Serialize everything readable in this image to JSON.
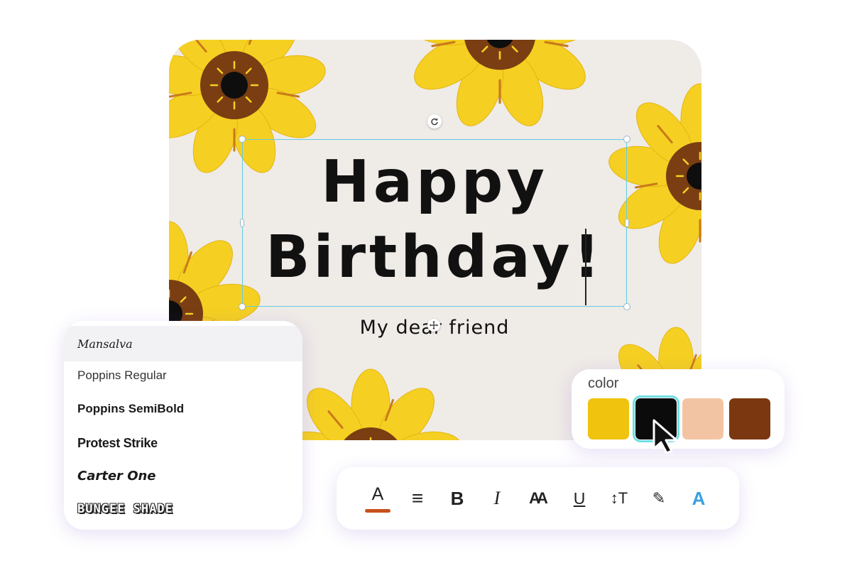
{
  "card": {
    "headline_line1": "Happy",
    "headline_line2": "Birthday!",
    "subline": "My dear friend",
    "background_color": "#efebe7",
    "petal_color": "#f5d022",
    "center_color": "#7a3e12",
    "seed_color": "#0e0e0e"
  },
  "font_panel": {
    "items": [
      {
        "label": "Mansalva",
        "selected": true
      },
      {
        "label": "Poppins Regular",
        "selected": false
      },
      {
        "label": "Poppins SemiBold",
        "selected": false
      },
      {
        "label": "Protest Strike",
        "selected": false
      },
      {
        "label": "Carter One",
        "selected": false
      },
      {
        "label": "BUNGEE SHADE",
        "selected": false
      }
    ]
  },
  "color_panel": {
    "title": "color",
    "swatches": [
      {
        "name": "yellow",
        "hex": "#f0c30f"
      },
      {
        "name": "black",
        "hex": "#0b0b0b",
        "selected": true
      },
      {
        "name": "peach",
        "hex": "#f3c4a4"
      },
      {
        "name": "brown",
        "hex": "#7b3810"
      }
    ]
  },
  "toolbar": {
    "tools": [
      {
        "name": "text-color",
        "glyph": "A",
        "active_color": "#c8501c"
      },
      {
        "name": "align",
        "glyph": "≡"
      },
      {
        "name": "bold",
        "glyph": "B"
      },
      {
        "name": "italic",
        "glyph": "I"
      },
      {
        "name": "text-case",
        "glyph": "AA"
      },
      {
        "name": "underline",
        "glyph": "U"
      },
      {
        "name": "line-spacing",
        "glyph": "↕T"
      },
      {
        "name": "highlight",
        "glyph": "✎"
      },
      {
        "name": "text-effects",
        "glyph": "A"
      }
    ]
  }
}
